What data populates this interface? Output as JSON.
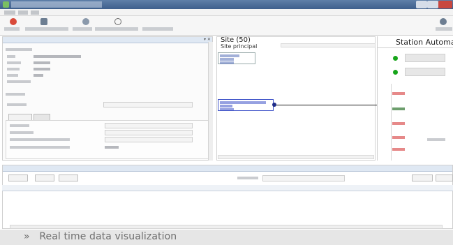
{
  "window": {
    "title": ""
  },
  "menu": {
    "items": [
      "",
      "",
      ""
    ]
  },
  "toolbar": {
    "items": [
      {
        "icon": "record-icon",
        "label": ""
      },
      {
        "icon": "refresh-icon",
        "label": ""
      },
      {
        "icon": "sync-icon",
        "label": ""
      },
      {
        "icon": "network-icon",
        "label": ""
      },
      {
        "icon": "settings-icon",
        "label": ""
      }
    ],
    "right_label": ""
  },
  "left_panel": {
    "header": "",
    "section": "",
    "fields": [
      {
        "label": "",
        "value": ""
      },
      {
        "label": "",
        "value": ""
      },
      {
        "label": "",
        "value": ""
      },
      {
        "label": "",
        "value": ""
      },
      {
        "label": "",
        "value": ""
      }
    ],
    "section2": "",
    "combo_label": "",
    "tabs": [
      "",
      ""
    ],
    "sub_rows": [
      "",
      "",
      "",
      ""
    ]
  },
  "site_canvas": {
    "title": "Site (50)",
    "subtitle": "Site principal",
    "node_top": [
      "",
      "",
      ""
    ],
    "node_sel": [
      "",
      "",
      ""
    ]
  },
  "station_panel": {
    "title": "Station Automatiq",
    "buttons": [
      "",
      ""
    ],
    "items": [
      "",
      "",
      "",
      "",
      "",
      ""
    ],
    "side_label": ""
  },
  "bottom_panel": {
    "header": "",
    "buttons": [
      "",
      "",
      ""
    ],
    "search_label": "",
    "right_buttons": [
      "",
      ""
    ],
    "columns": [
      "",
      "",
      "",
      "",
      "",
      "",
      "",
      "",
      ""
    ],
    "rows": [
      [
        "",
        "",
        "",
        "",
        "",
        "",
        "",
        "",
        ""
      ],
      [
        "",
        "",
        "",
        "",
        "",
        "",
        "",
        "",
        ""
      ],
      [
        "",
        "",
        "",
        "",
        "",
        "",
        "",
        "",
        ""
      ],
      [
        "",
        "",
        "",
        "",
        "",
        "",
        "",
        "",
        ""
      ]
    ]
  },
  "caption": {
    "bullet": "»",
    "text": "Real time data visualization"
  },
  "colors": {
    "accent": "#3e5f8c",
    "status_ok": "#17a51a",
    "alert": "#d84a4a",
    "link_blue": "#1e2b88"
  }
}
